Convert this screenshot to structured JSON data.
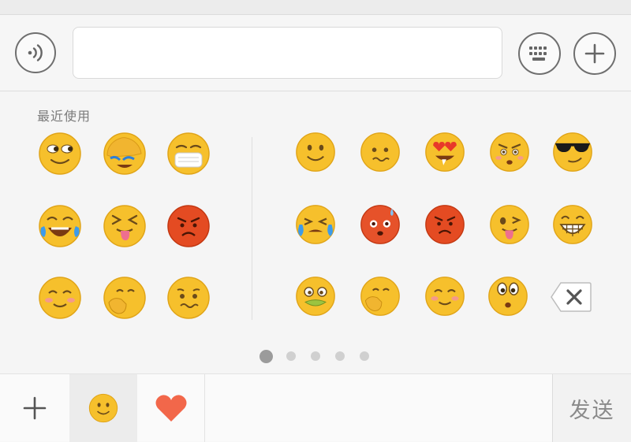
{
  "input_bar": {
    "text_value": "",
    "voice_icon": "voice-icon",
    "keyboard_icon": "keyboard-icon",
    "plus_icon": "plus-icon"
  },
  "emoji_panel": {
    "recent_label": "最近使用",
    "recent_emojis": [
      "smirk-eyes-side",
      "facepalm",
      "mask",
      "tears-of-joy",
      "tongue-squint",
      "angry-red",
      "blush",
      "shy-hand",
      "wavy-mouth"
    ],
    "page_emojis": [
      "smile",
      "wavy-mouth",
      "heart-eyes",
      "angry-frown",
      "sunglasses",
      "crying-loud",
      "embarrassed-red",
      "angry-red",
      "wink-tongue",
      "grin-teeth",
      "sick",
      "shy-hand",
      "blush",
      "eyes-wide"
    ],
    "delete_icon": "backspace-icon",
    "page_count": 5,
    "active_page": 1
  },
  "bottom_bar": {
    "add_icon": "plus-icon",
    "emoji_tab_icon": "smiley-icon",
    "favorites_tab_icon": "heart-icon",
    "send_label": "发送"
  },
  "colors": {
    "emoji_yellow": "#f6c02c",
    "heart": "#f2674a",
    "send_text": "#8a8a8a"
  }
}
